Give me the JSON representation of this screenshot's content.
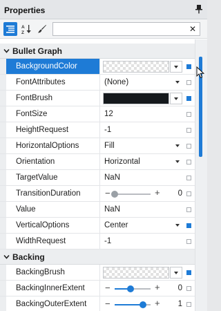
{
  "panel": {
    "title": "Properties"
  },
  "toolbar": {
    "search_value": ""
  },
  "categories": [
    {
      "label": "Bullet Graph"
    },
    {
      "label": "Backing"
    }
  ],
  "rows": [
    {
      "name": "BackgroundColor",
      "value": "",
      "kind": "color-checker",
      "selected": true,
      "mark_set": true
    },
    {
      "name": "FontAttributes",
      "value": "(None)",
      "kind": "dropdown",
      "mark_set": false
    },
    {
      "name": "FontBrush",
      "value": "",
      "kind": "color-dark",
      "mark_set": true
    },
    {
      "name": "FontSize",
      "value": "12",
      "kind": "text",
      "mark_set": false
    },
    {
      "name": "HeightRequest",
      "value": "-1",
      "kind": "text",
      "mark_set": false
    },
    {
      "name": "HorizontalOptions",
      "value": "Fill",
      "kind": "dropdown",
      "mark_set": false
    },
    {
      "name": "Orientation",
      "value": "Horizontal",
      "kind": "dropdown",
      "mark_set": false
    },
    {
      "name": "TargetValue",
      "value": "NaN",
      "kind": "text",
      "mark_set": false
    },
    {
      "name": "TransitionDuration",
      "value": "0",
      "kind": "slider",
      "level": 0.0,
      "mark_set": false
    },
    {
      "name": "Value",
      "value": "NaN",
      "kind": "text",
      "mark_set": false
    },
    {
      "name": "VerticalOptions",
      "value": "Center",
      "kind": "dropdown",
      "mark_set": true
    },
    {
      "name": "WidthRequest",
      "value": "-1",
      "kind": "text",
      "mark_set": false
    },
    {
      "name": "BackingBrush",
      "value": "",
      "kind": "color-checker",
      "mark_set": true
    },
    {
      "name": "BackingInnerExtent",
      "value": "0",
      "kind": "slider",
      "level": 0.45,
      "mark_set": false
    },
    {
      "name": "BackingOuterExtent",
      "value": "1",
      "kind": "slider",
      "level": 0.78,
      "mark_set": false
    }
  ],
  "icons": {
    "pin": "pin-icon",
    "categorized": "categorized-list-icon",
    "alphabetical": "sort-az-icon",
    "brush": "brush-icon",
    "clear": "close-icon"
  },
  "colors": {
    "accent": "#1e7bd6",
    "font_brush": "#15191d"
  }
}
